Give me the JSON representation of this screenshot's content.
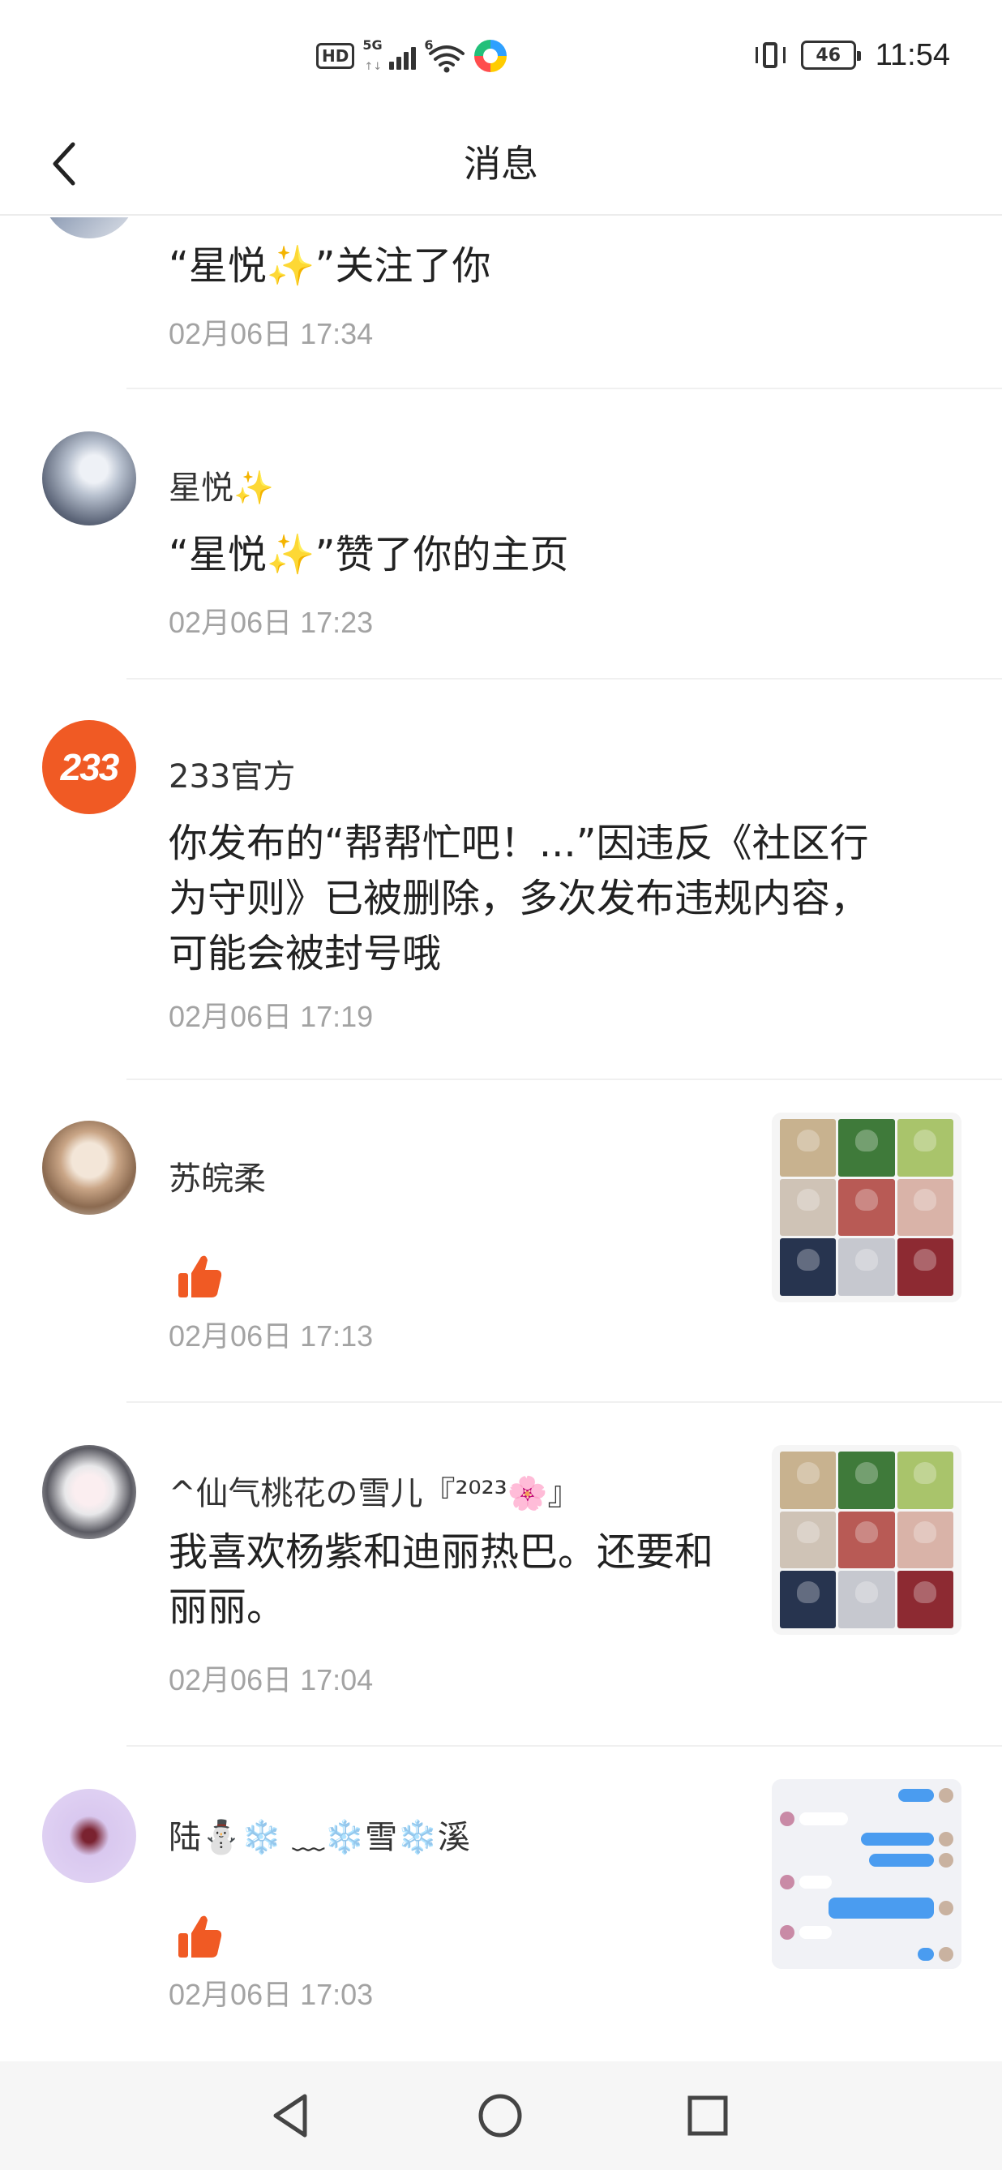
{
  "status_bar": {
    "hd": "HD",
    "network": "5G",
    "wifi_label": "6",
    "battery": "46",
    "time": "11:54"
  },
  "header": {
    "title": "消息"
  },
  "messages": [
    {
      "type": "follow",
      "user": "",
      "content": "“星悦✨”关注了你",
      "time": "02月06日 17:34"
    },
    {
      "type": "like_profile",
      "user": "星悦✨",
      "content": "“星悦✨”赞了你的主页",
      "time": "02月06日 17:23"
    },
    {
      "type": "official",
      "user": "233官方",
      "avatar_text": "233",
      "content": "你发布的“帮帮忙吧！...”因违反《社区行为守则》已被删除，多次发布违规内容，可能会被封号哦",
      "time": "02月06日 17:19"
    },
    {
      "type": "like_post",
      "user": "苏皖柔",
      "content": "",
      "time": "02月06日 17:13"
    },
    {
      "type": "comment",
      "user": "^仙气桃花の雪儿『²⁰²³🌸』",
      "content": "我喜欢杨紫和迪丽热巴。还要和丽丽。",
      "time": "02月06日 17:04"
    },
    {
      "type": "like_post",
      "user": "陆⛄❄️ ﹏❄️雪❄️溪",
      "content": "",
      "time": "02月06日 17:03"
    }
  ],
  "colors": {
    "accent": "#f05a24",
    "timestamp": "#a3a3a3",
    "divider": "#f0f0f0"
  },
  "icons": {
    "back": "chevron-left-icon",
    "like": "thumbs-up-icon",
    "nav_back": "triangle-back-icon",
    "nav_home": "circle-home-icon",
    "nav_recent": "square-recent-icon"
  }
}
